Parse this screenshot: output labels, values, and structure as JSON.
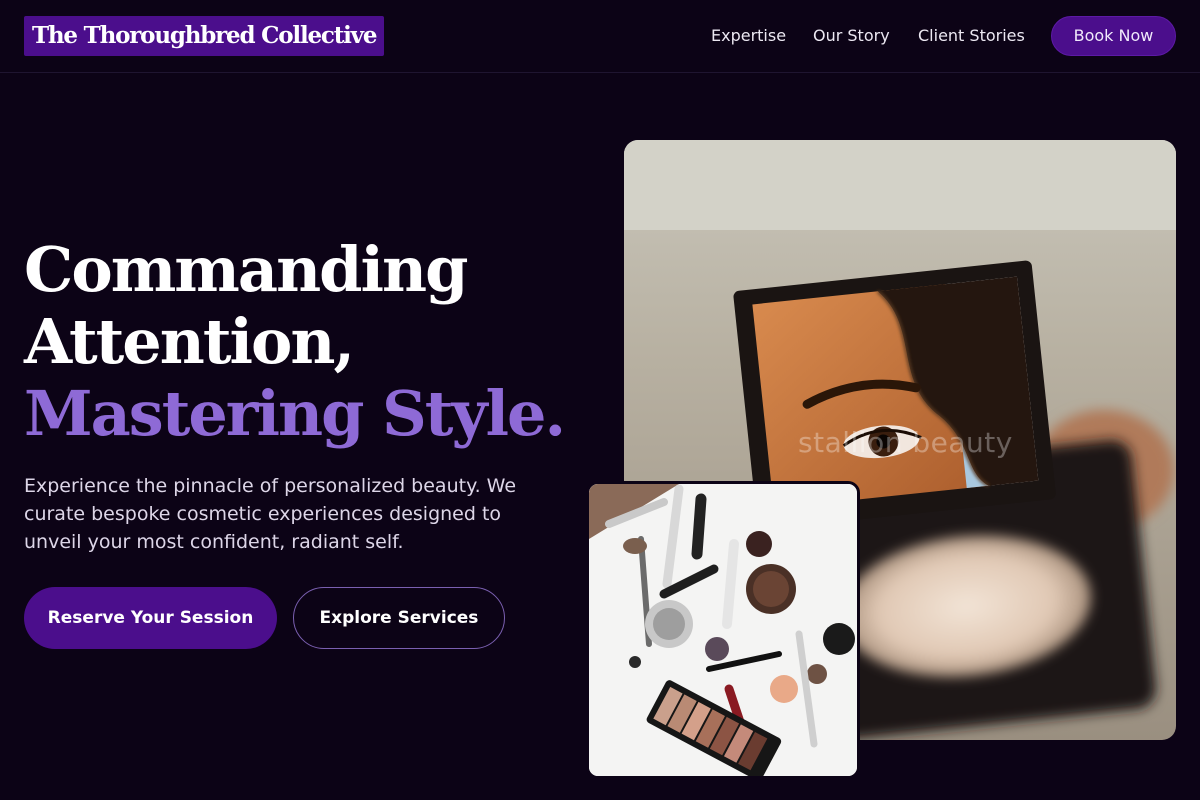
{
  "header": {
    "logo": "The Thoroughbred Collective",
    "nav": [
      {
        "label": "Expertise"
      },
      {
        "label": "Our Story"
      },
      {
        "label": "Client Stories"
      }
    ],
    "cta_label": "Book Now"
  },
  "hero": {
    "headline_line1": "Commanding",
    "headline_line2": "Attention,",
    "headline_accent": "Mastering Style.",
    "subcopy": "Experience the pinnacle of personalized beauty. We curate bespoke cosmetic experiences designed to unveil your most confident, radiant self.",
    "primary_button": "Reserve Your Session",
    "secondary_button": "Explore Services",
    "watermark": "stallion beauty"
  },
  "colors": {
    "background": "#0c0316",
    "accent_purple": "#4b0e8c",
    "headline_accent": "#8e6ad6"
  }
}
